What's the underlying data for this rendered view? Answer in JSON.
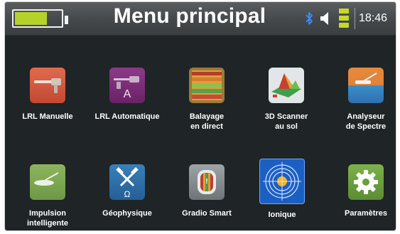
{
  "statusbar": {
    "title": "Menu principal",
    "time": "18:46",
    "battery_level": 0.7,
    "icons": [
      "battery-icon",
      "bluetooth-icon",
      "volume-icon",
      "signal-strength-icon"
    ]
  },
  "tiles": [
    {
      "label": "LRL Manuelle",
      "icon": "lrl-manual-icon",
      "color": "#d2553c"
    },
    {
      "label": "LRL Automatique",
      "icon": "lrl-automatic-icon",
      "color": "#7a2b78"
    },
    {
      "label": "Balayage\nen direct",
      "icon": "live-scan-icon",
      "color": "#c5a84b"
    },
    {
      "label": "3D Scanner\nau sol",
      "icon": "ground-3d-scanner-icon",
      "color": "#e3e6e8"
    },
    {
      "label": "Analyseur\nde Spectre",
      "icon": "spectrum-analyzer-icon",
      "color": "#d0833b"
    },
    {
      "label": "Impulsion\nintelligente",
      "icon": "smart-pulse-icon",
      "color": "#79a151"
    },
    {
      "label": "Géophysique",
      "icon": "geophysics-icon",
      "color": "#2f71a6"
    },
    {
      "label": "Gradio Smart",
      "icon": "gradio-smart-icon",
      "color": "#888d90"
    },
    {
      "label": "Ionique",
      "icon": "ionic-icon",
      "color": "#1c63c8"
    },
    {
      "label": "Paramètres",
      "icon": "settings-gear-icon",
      "color": "#6fa03f"
    }
  ]
}
